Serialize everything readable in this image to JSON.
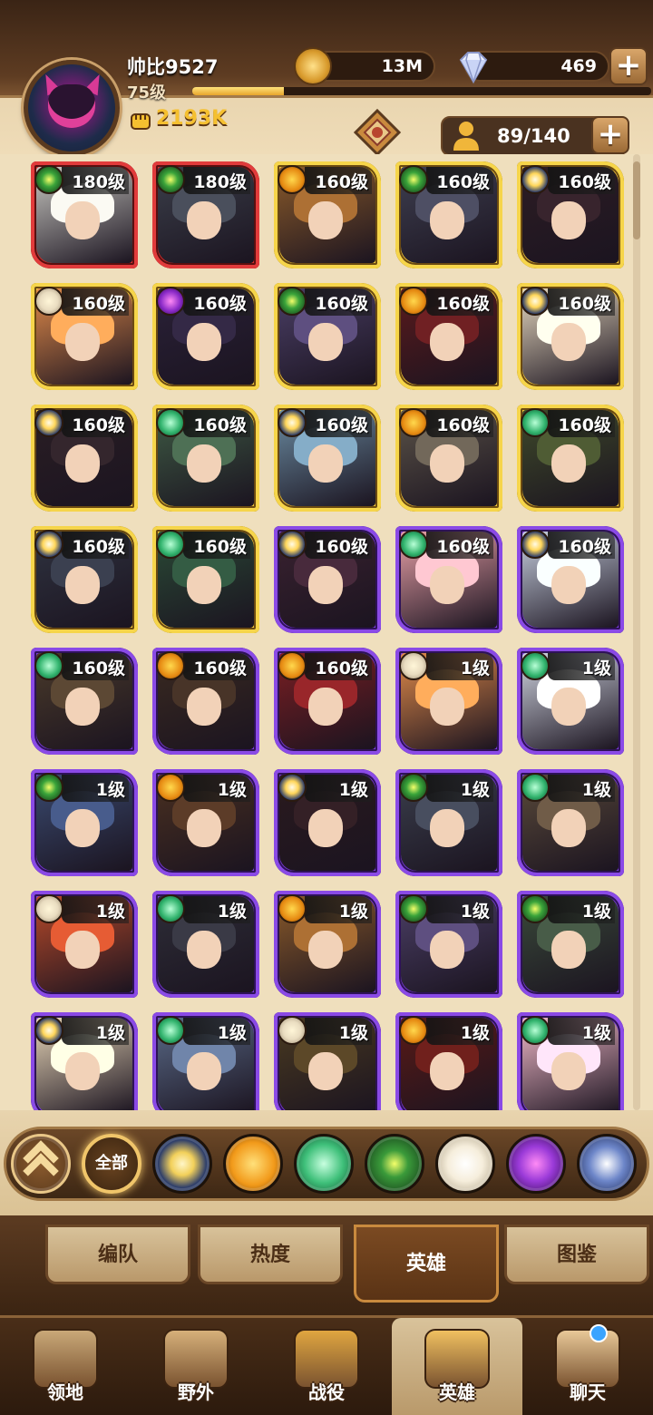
{
  "player": {
    "name": "帅比9527",
    "level": "75级",
    "power": "2193K",
    "xp_fraction": 0.2
  },
  "currency": {
    "gold": "13M",
    "gems": "469"
  },
  "roster": {
    "count": "89/140"
  },
  "heroes": [
    {
      "level": "180级",
      "frame": "red",
      "faction": "graveborn",
      "art": "#c9c8c2"
    },
    {
      "level": "180级",
      "frame": "red",
      "faction": "graveborn",
      "art": "#3b3f4a"
    },
    {
      "level": "160级",
      "frame": "gold",
      "faction": "mauler",
      "art": "#8a5a2a"
    },
    {
      "level": "160级",
      "frame": "gold",
      "faction": "graveborn",
      "art": "#3e3f50"
    },
    {
      "level": "160级",
      "frame": "gold",
      "faction": "lightbearer2",
      "art": "#2d1d24"
    },
    {
      "level": "160级",
      "frame": "gold",
      "faction": "celestial",
      "art": "#e08a4a"
    },
    {
      "level": "160级",
      "frame": "gold",
      "faction": "hypogean",
      "art": "#2a2138"
    },
    {
      "level": "160级",
      "frame": "gold",
      "faction": "graveborn",
      "art": "#4b3f66"
    },
    {
      "level": "160级",
      "frame": "gold",
      "faction": "mauler",
      "art": "#5a1a1c"
    },
    {
      "level": "160级",
      "frame": "gold",
      "faction": "lightbearer2",
      "art": "#e6d8bf"
    },
    {
      "level": "160级",
      "frame": "gold",
      "faction": "lightbearer2",
      "art": "#2a1e24"
    },
    {
      "level": "160级",
      "frame": "gold",
      "faction": "wilder",
      "art": "#3e5a44"
    },
    {
      "level": "160级",
      "frame": "gold",
      "faction": "lightbearer2",
      "art": "#6a8aa0"
    },
    {
      "level": "160级",
      "frame": "gold",
      "faction": "mauler",
      "art": "#5b5348"
    },
    {
      "level": "160级",
      "frame": "gold",
      "faction": "wilder",
      "art": "#3f4a2a"
    },
    {
      "level": "160级",
      "frame": "gold",
      "faction": "lightbearer2",
      "art": "#2f3340"
    },
    {
      "level": "160级",
      "frame": "gold",
      "faction": "wilder",
      "art": "#2a4a36"
    },
    {
      "level": "160级",
      "frame": "purple",
      "faction": "lightbearer2",
      "art": "#3a2230"
    },
    {
      "level": "160级",
      "frame": "purple",
      "faction": "wilder",
      "art": "#e8a0a8"
    },
    {
      "level": "160级",
      "frame": "purple",
      "faction": "lightbearer2",
      "art": "#c8d0e0"
    },
    {
      "level": "160级",
      "frame": "purple",
      "faction": "wilder",
      "art": "#4a3a2a"
    },
    {
      "level": "160级",
      "frame": "purple",
      "faction": "mauler",
      "art": "#3a2a20"
    },
    {
      "level": "160级",
      "frame": "purple",
      "faction": "mauler",
      "art": "#7a1e22"
    },
    {
      "level": "1级",
      "frame": "purple",
      "faction": "celestial",
      "art": "#e08a4a"
    },
    {
      "level": "1级",
      "frame": "purple",
      "faction": "wilder",
      "art": "#d0d4e0"
    },
    {
      "level": "1级",
      "frame": "purple",
      "faction": "graveborn",
      "art": "#3a4a70"
    },
    {
      "level": "1级",
      "frame": "purple",
      "faction": "mauler",
      "art": "#4a3020"
    },
    {
      "level": "1级",
      "frame": "purple",
      "faction": "lightbearer2",
      "art": "#2a1a1e"
    },
    {
      "level": "1级",
      "frame": "purple",
      "faction": "graveborn",
      "art": "#3a3e4c"
    },
    {
      "level": "1级",
      "frame": "purple",
      "faction": "wilder",
      "art": "#5a4a3a"
    },
    {
      "level": "1级",
      "frame": "purple",
      "faction": "celestial",
      "art": "#b84a2a"
    },
    {
      "level": "1级",
      "frame": "purple",
      "faction": "wilder",
      "art": "#2e2e38"
    },
    {
      "level": "1级",
      "frame": "purple",
      "faction": "mauler",
      "art": "#8a5a2a"
    },
    {
      "level": "1级",
      "frame": "purple",
      "faction": "graveborn",
      "art": "#4b3f66"
    },
    {
      "level": "1级",
      "frame": "purple",
      "faction": "graveborn",
      "art": "#3a4a3a"
    },
    {
      "level": "1级",
      "frame": "purple",
      "faction": "lightbearer2",
      "art": "#e8d6b8"
    },
    {
      "level": "1级",
      "frame": "purple",
      "faction": "wilder",
      "art": "#5a6a88"
    },
    {
      "level": "1级",
      "frame": "purple",
      "faction": "celestial",
      "art": "#4a3a20"
    },
    {
      "level": "1级",
      "frame": "purple",
      "faction": "mauler",
      "art": "#5a1a16"
    },
    {
      "level": "1级",
      "frame": "purple",
      "faction": "wilder",
      "art": "#f0b8c8"
    }
  ],
  "filters": {
    "all_label": "全部",
    "factions": [
      {
        "name": "lightbearer",
        "color": "#f2d05a"
      },
      {
        "name": "mauler",
        "color": "#f29a1a"
      },
      {
        "name": "wilder",
        "color": "#3fc07a"
      },
      {
        "name": "graveborn",
        "color": "#6adc3a"
      },
      {
        "name": "celestial",
        "color": "#f6eedc"
      },
      {
        "name": "hypogean",
        "color": "#9a3ad8"
      },
      {
        "name": "dimensional",
        "color": "#6d86c9"
      }
    ]
  },
  "subtabs": [
    {
      "label": "编队",
      "active": false
    },
    {
      "label": "热度",
      "active": false
    },
    {
      "label": "英雄",
      "active": true
    },
    {
      "label": "图鉴",
      "active": false
    }
  ],
  "nav": [
    {
      "label": "领地",
      "active": false,
      "icon": "castle-icon"
    },
    {
      "label": "野外",
      "active": false,
      "icon": "scroll-map-icon"
    },
    {
      "label": "战役",
      "active": false,
      "icon": "sword-shield-icon"
    },
    {
      "label": "英雄",
      "active": true,
      "icon": "helmet-icon"
    },
    {
      "label": "聊天",
      "active": false,
      "icon": "chat-bubble-icon"
    }
  ],
  "colors": {
    "accent_gold": "#f5c030",
    "frame_gold": "#f2c73a",
    "frame_red": "#d32c2c",
    "frame_purple": "#7a3ad8",
    "panel_bg": "#efdfbd"
  }
}
